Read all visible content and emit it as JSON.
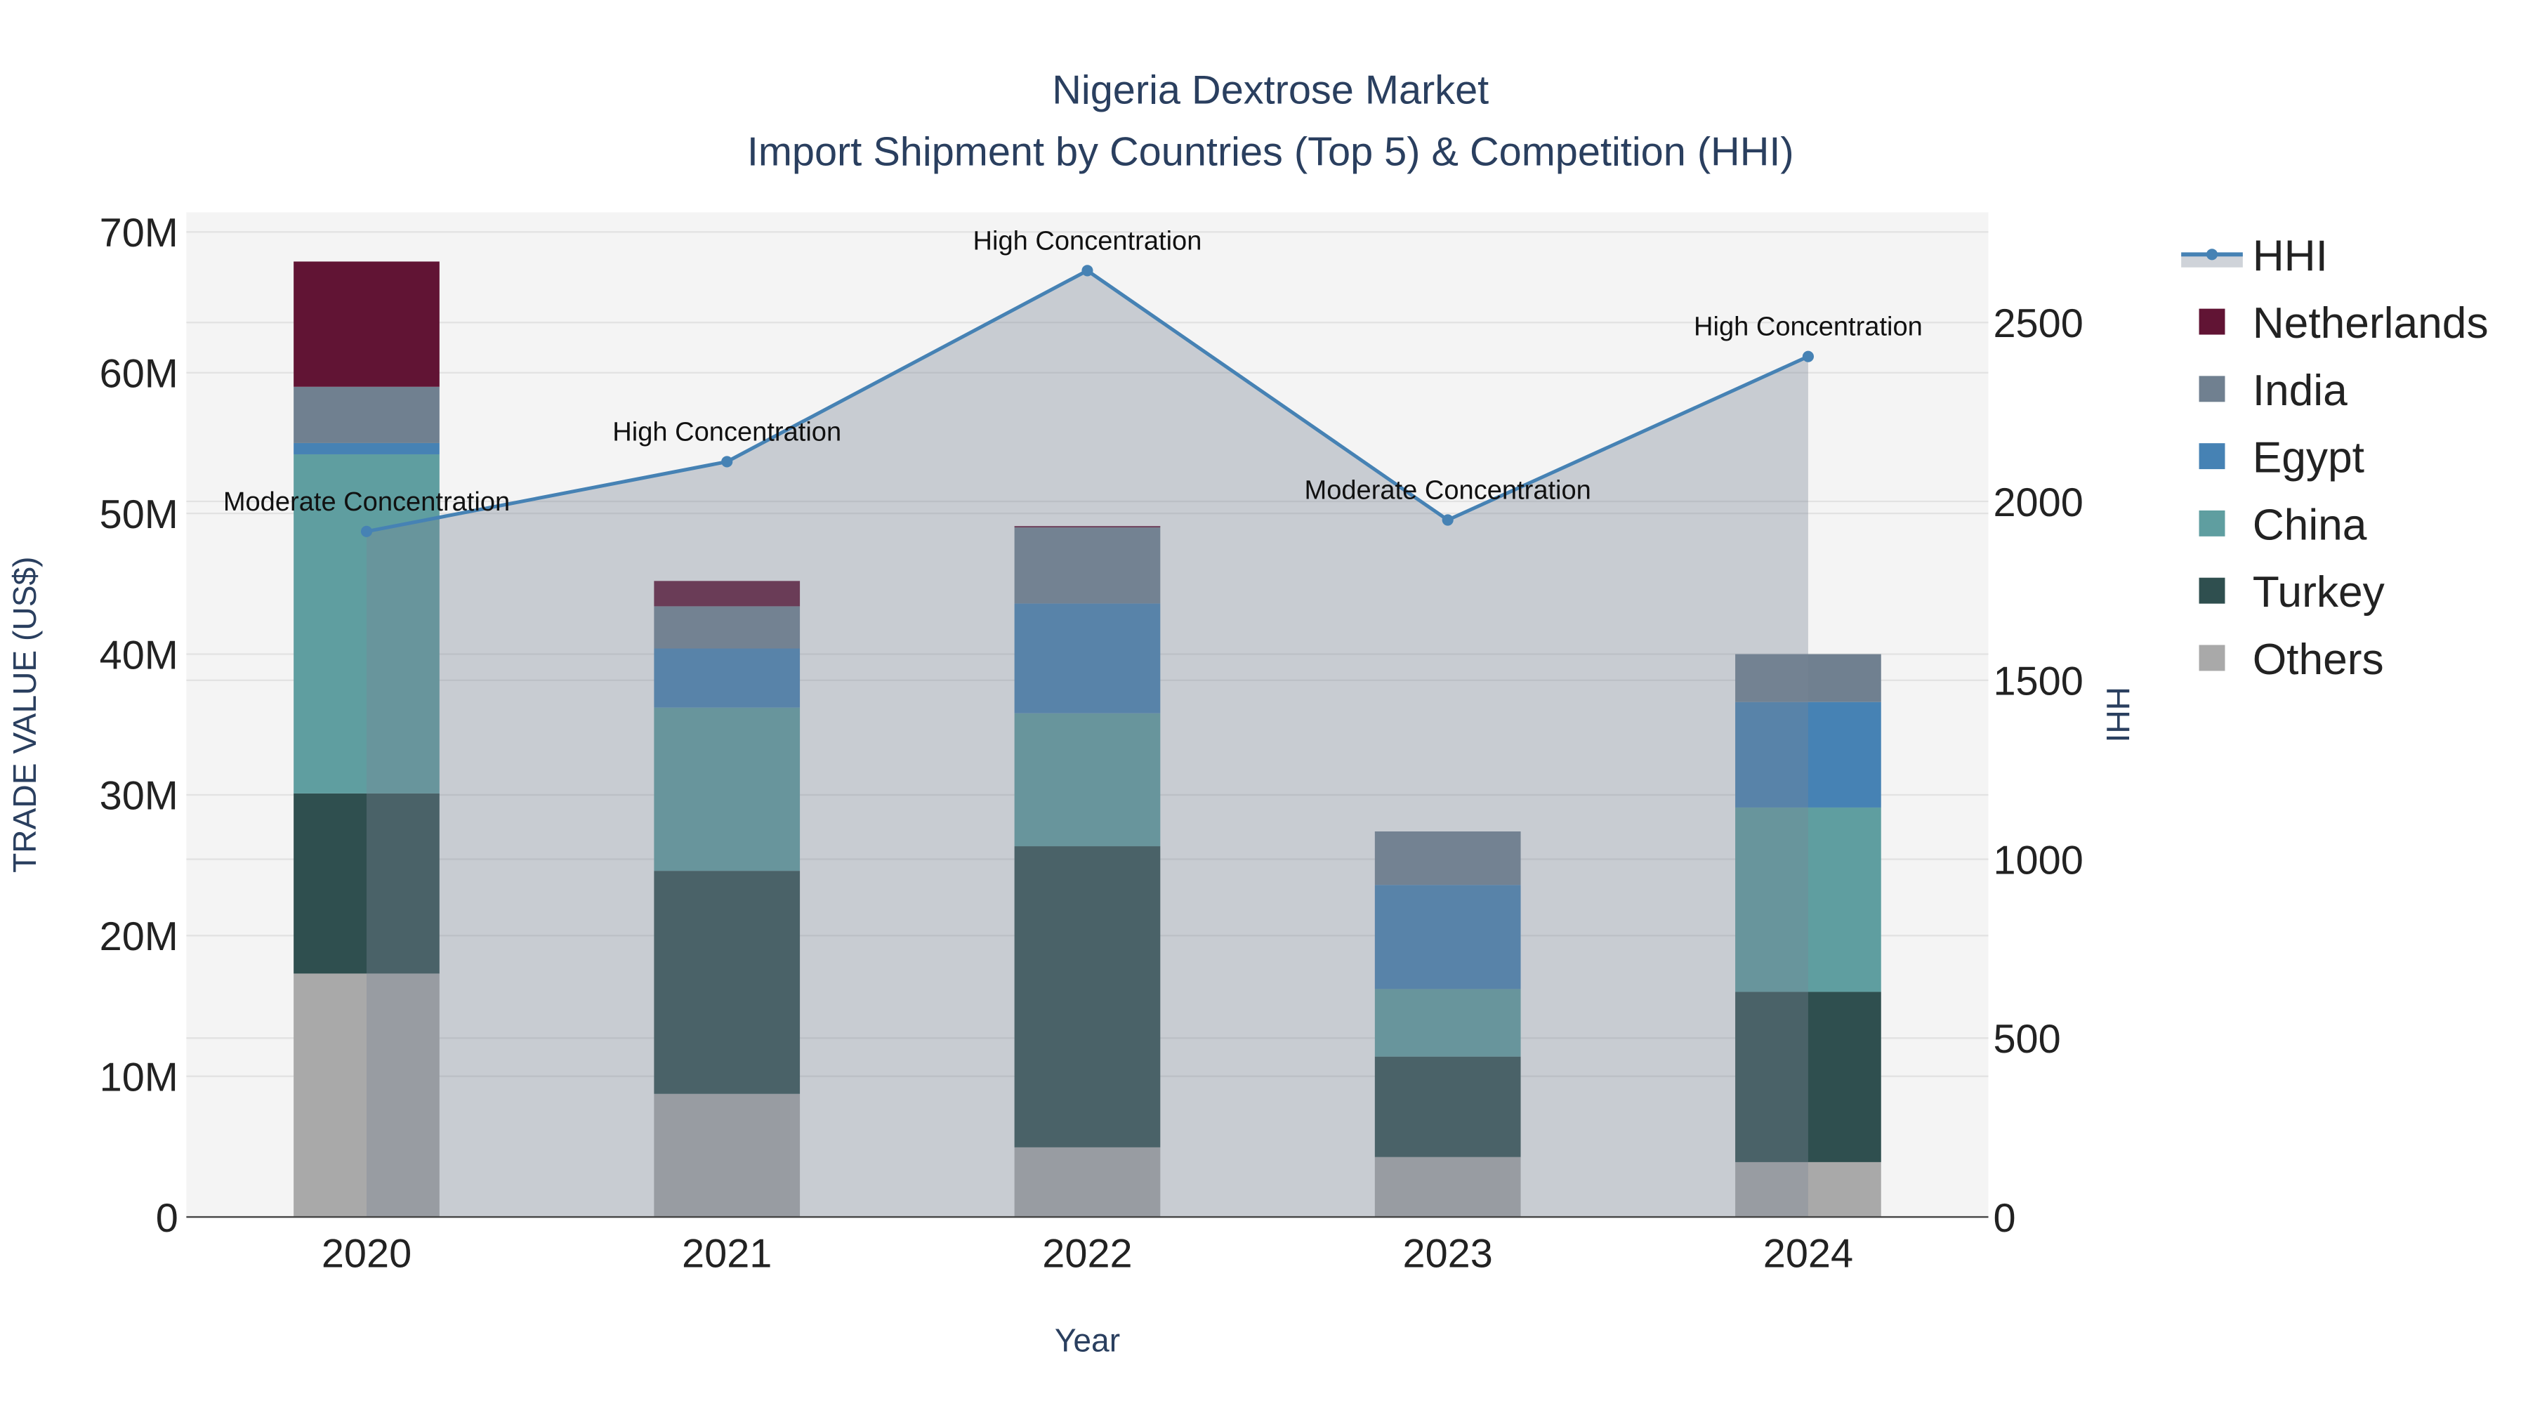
{
  "chart_data": {
    "type": "bar",
    "title": "Nigeria Dextrose Market",
    "subtitle": "Import Shipment by Countries (Top 5) & Competition (HHI)",
    "xlabel": "Year",
    "ylabel": "TRADE VALUE (US$)",
    "y2label": "HHI",
    "categories": [
      "2020",
      "2021",
      "2022",
      "2023",
      "2024"
    ],
    "ylim": [
      0,
      71400000
    ],
    "y2lim": [
      0,
      2808
    ],
    "yticks": [
      0,
      10000000,
      20000000,
      30000000,
      40000000,
      50000000,
      60000000,
      70000000
    ],
    "ytick_labels": [
      "0",
      "10M",
      "20M",
      "30M",
      "40M",
      "50M",
      "60M",
      "70M"
    ],
    "y2ticks": [
      0,
      500,
      1000,
      1500,
      2000,
      2500
    ],
    "y2tick_labels": [
      "0",
      "500",
      "1000",
      "1500",
      "2000",
      "2500"
    ],
    "grid": true,
    "legend_position": "right",
    "series": [
      {
        "name": "Others",
        "color": "#A9A9A9",
        "values": [
          17300000,
          8750000,
          4950000,
          4260000,
          3900000
        ]
      },
      {
        "name": "Turkey",
        "color": "#2F4F4F",
        "values": [
          12800000,
          15850000,
          21400000,
          7140000,
          12100000
        ]
      },
      {
        "name": "China",
        "color": "#5F9EA0",
        "values": [
          24100000,
          11600000,
          9450000,
          4800000,
          13100000
        ]
      },
      {
        "name": "Egypt",
        "color": "#4682B4",
        "values": [
          800000,
          4200000,
          7800000,
          7400000,
          7500000
        ]
      },
      {
        "name": "India",
        "color": "#708090",
        "values": [
          4000000,
          3000000,
          5400000,
          3800000,
          3400000
        ]
      },
      {
        "name": "Netherlands",
        "color": "#611434",
        "values": [
          8900000,
          1800000,
          100000,
          0,
          0
        ]
      }
    ],
    "hhi": {
      "name": "HHI",
      "color": "#4682B4",
      "values": [
        1916,
        2111,
        2645,
        1948,
        2405
      ],
      "annotations": [
        "Moderate Concentration",
        "High Concentration",
        "High Concentration",
        "Moderate Concentration",
        "High Concentration"
      ]
    },
    "legend_order": [
      "HHI",
      "Netherlands",
      "India",
      "Egypt",
      "China",
      "Turkey",
      "Others"
    ]
  }
}
